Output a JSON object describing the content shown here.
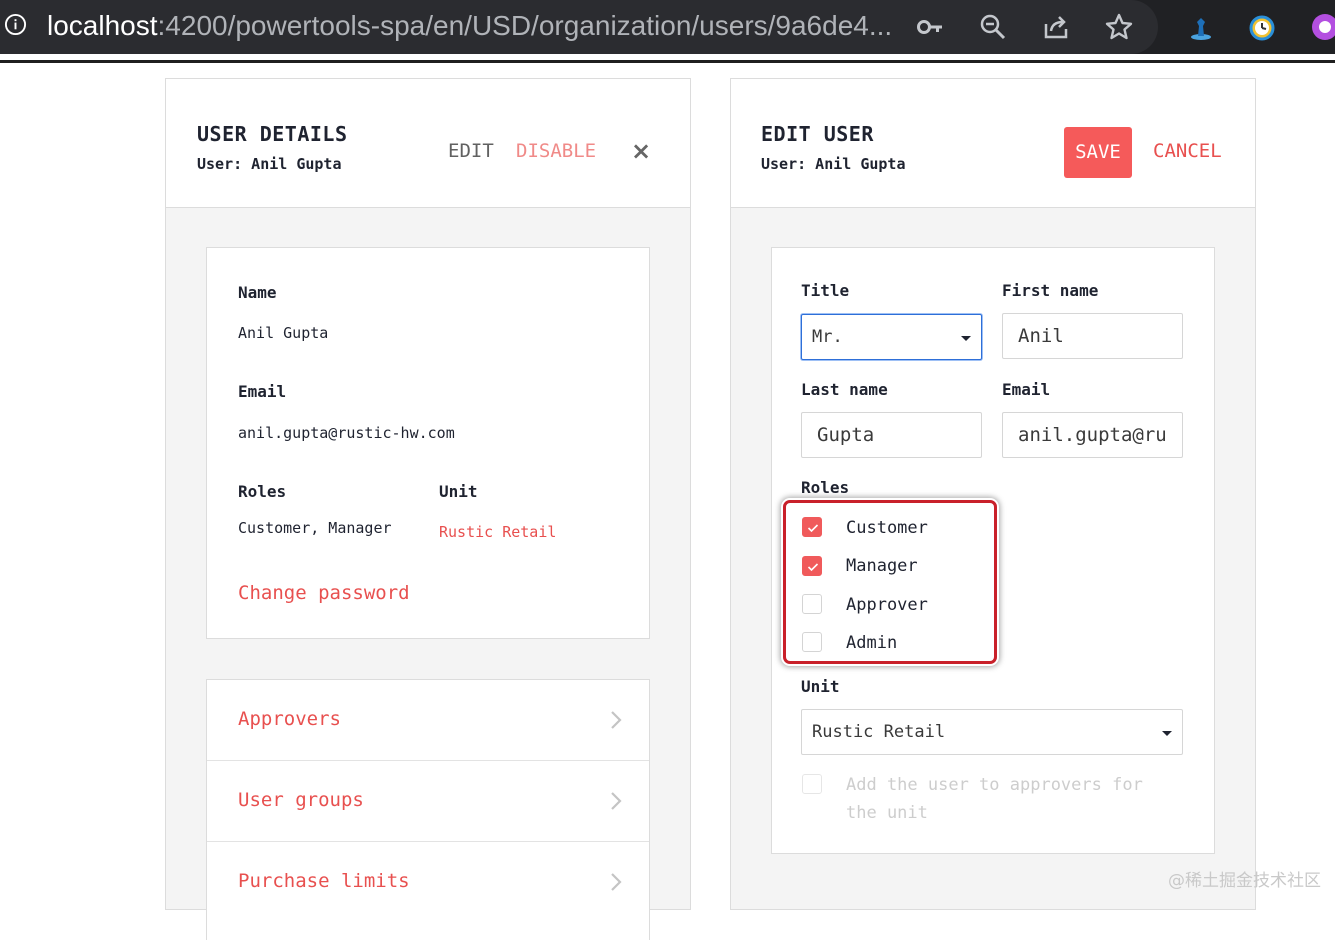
{
  "browser": {
    "url_host": "localhost",
    "url_path": ":4200/powertools-spa/en/USD/organization/users/9a6de4..."
  },
  "details": {
    "title": "USER DETAILS",
    "subtitle": "User: Anil Gupta",
    "edit_label": "EDIT",
    "disable_label": "DISABLE",
    "close_symbol": "×",
    "name_label": "Name",
    "name_value": "Anil Gupta",
    "email_label": "Email",
    "email_value": "anil.gupta@rustic-hw.com",
    "roles_label": "Roles",
    "roles_value": "Customer, Manager",
    "unit_label": "Unit",
    "unit_value": "Rustic Retail",
    "change_password": "Change password",
    "nav": [
      "Approvers",
      "User groups",
      "Purchase limits"
    ]
  },
  "edit": {
    "title": "EDIT USER",
    "subtitle": "User: Anil Gupta",
    "save_label": "SAVE",
    "cancel_label": "CANCEL",
    "title_label": "Title",
    "title_value": "Mr.",
    "first_name_label": "First name",
    "first_name_value": "Anil",
    "last_name_label": "Last name",
    "last_name_value": "Gupta",
    "email_label": "Email",
    "email_value": "anil.gupta@ru",
    "roles_label": "Roles",
    "roles": [
      {
        "label": "Customer",
        "checked": true
      },
      {
        "label": "Manager",
        "checked": true
      },
      {
        "label": "Approver",
        "checked": false
      },
      {
        "label": "Admin",
        "checked": false
      }
    ],
    "unit_label": "Unit",
    "unit_value": "Rustic Retail",
    "approver_line1": "Add the user to approvers for",
    "approver_line2": "the unit"
  },
  "watermark": "@稀土掘金技术社区",
  "colors": {
    "accent": "#e8504f",
    "save_bg": "#f55a5a",
    "highlight": "#c9202a"
  }
}
